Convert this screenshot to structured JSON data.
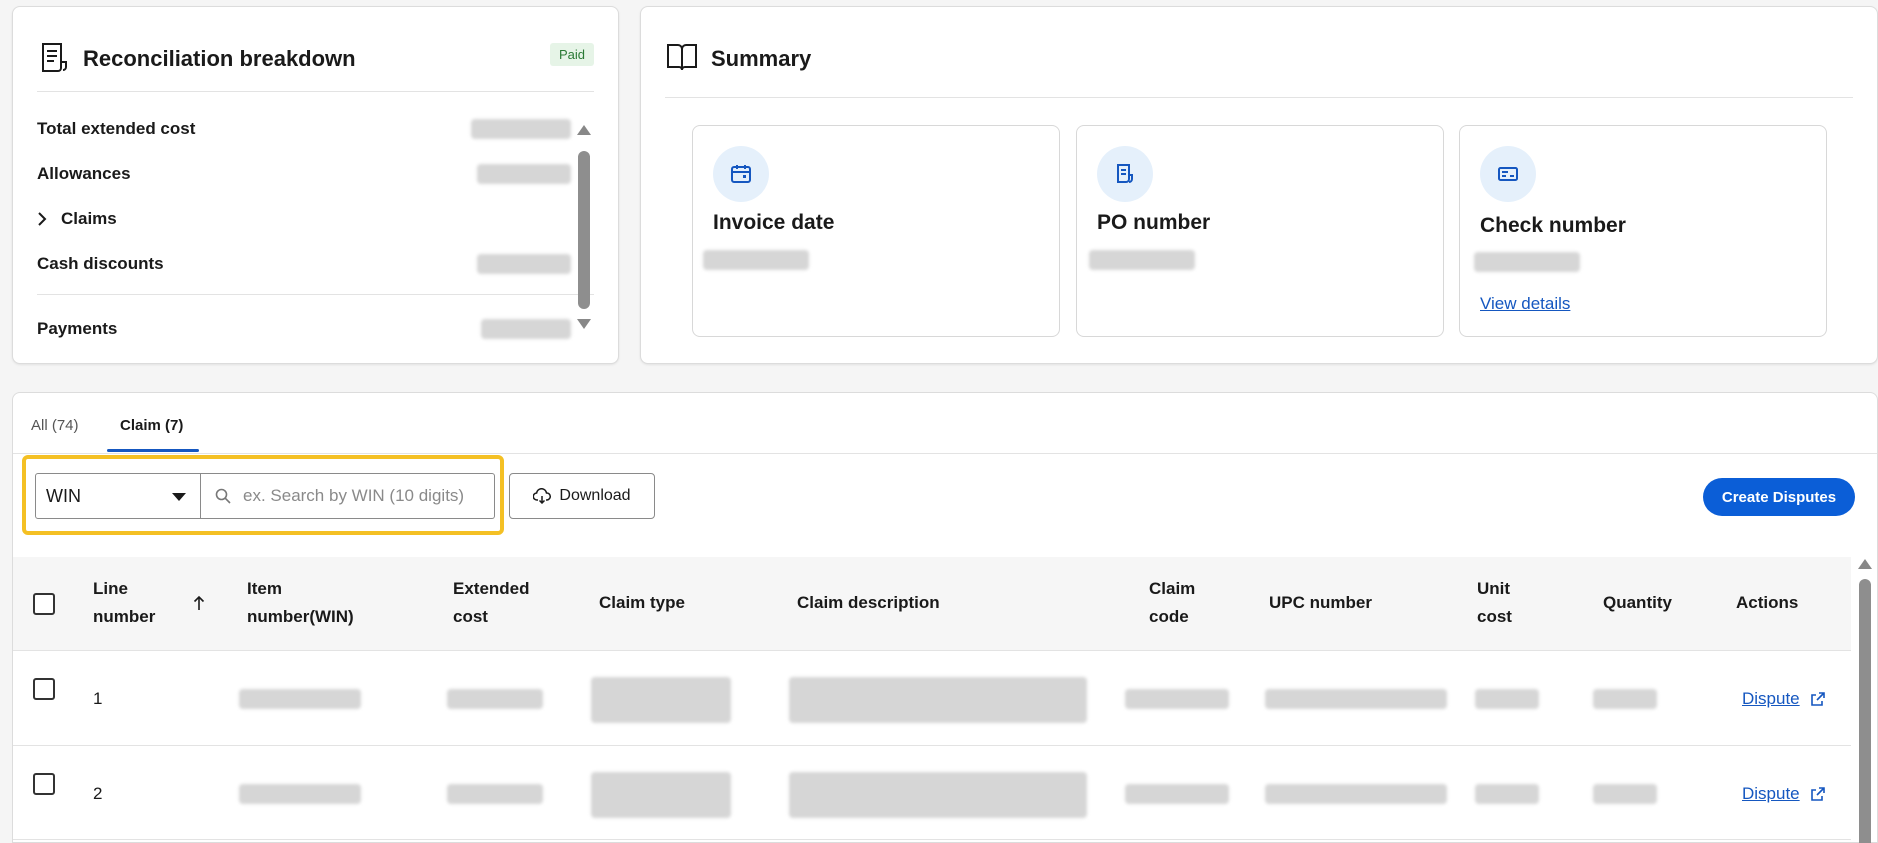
{
  "reconciliation": {
    "title": "Reconciliation breakdown",
    "status": "Paid",
    "rows": [
      {
        "label": "Total extended cost"
      },
      {
        "label": "Allowances"
      },
      {
        "label": "Claims"
      },
      {
        "label": "Cash discounts"
      },
      {
        "label": "Payments"
      }
    ]
  },
  "summary": {
    "title": "Summary",
    "tiles": [
      {
        "label": "Invoice date",
        "icon": "calendar-icon"
      },
      {
        "label": "PO number",
        "icon": "document-icon"
      },
      {
        "label": "Check number",
        "icon": "check-icon",
        "link": "View details"
      }
    ]
  },
  "tabs": [
    {
      "label": "All (74)"
    },
    {
      "label": "Claim (7)"
    }
  ],
  "filters": {
    "search_type": "WIN",
    "search_placeholder": "ex. Search by WIN (10 digits)",
    "download_label": "Download",
    "create_label": "Create Disputes"
  },
  "table": {
    "headers": {
      "line_number": "Line number",
      "item_number": "Item number(WIN)",
      "extended_cost": "Extended cost",
      "claim_type": "Claim type",
      "claim_description": "Claim description",
      "claim_code": "Claim code",
      "upc_number": "UPC number",
      "unit_cost": "Unit cost",
      "quantity": "Quantity",
      "actions": "Actions"
    },
    "rows": [
      {
        "line": "1",
        "action": "Dispute"
      },
      {
        "line": "2",
        "action": "Dispute"
      }
    ]
  },
  "colors": {
    "accent": "#0b5ed7",
    "link": "#1557c0",
    "highlight": "#f4c024",
    "paid_bg": "#e6f4e7"
  }
}
